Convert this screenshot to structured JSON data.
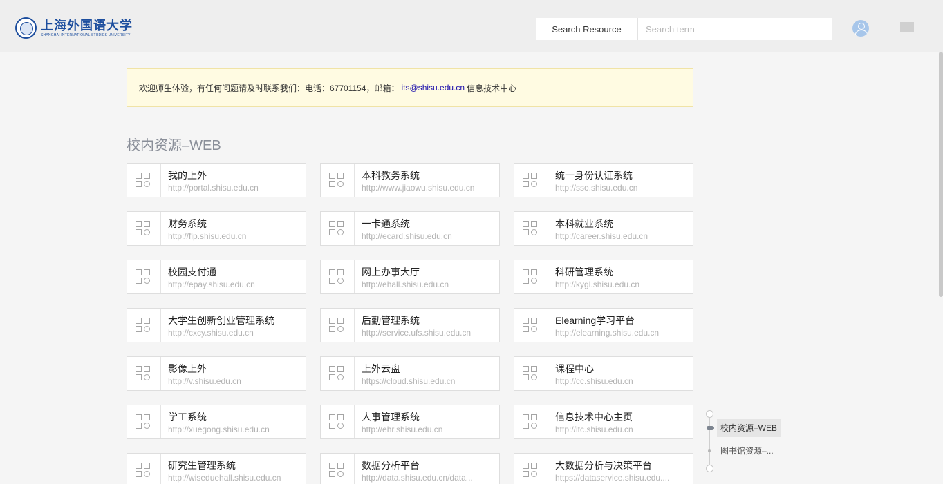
{
  "header": {
    "logo_cn": "上海外国语大学",
    "logo_en": "SHANGHAI INTERNATIONAL STUDIES UNIVERSITY",
    "search_button": "Search Resource",
    "search_placeholder": "Search term"
  },
  "notice": {
    "text_before": "欢迎师生体验，有任何问题请及时联系我们：电话：67701154，邮箱：",
    "email": "its@shisu.edu.cn",
    "text_after": "信息技术中心"
  },
  "section": {
    "title": "校内资源–WEB"
  },
  "cards": [
    {
      "title": "我的上外",
      "url": "http://portal.shisu.edu.cn"
    },
    {
      "title": "本科教务系统",
      "url": "http://www.jiaowu.shisu.edu.cn"
    },
    {
      "title": "统一身份认证系统",
      "url": "http://sso.shisu.edu.cn"
    },
    {
      "title": "财务系统",
      "url": "http://fip.shisu.edu.cn"
    },
    {
      "title": "一卡通系统",
      "url": "http://ecard.shisu.edu.cn"
    },
    {
      "title": "本科就业系统",
      "url": "http://career.shisu.edu.cn"
    },
    {
      "title": "校园支付通",
      "url": "http://epay.shisu.edu.cn"
    },
    {
      "title": "网上办事大厅",
      "url": "http://ehall.shisu.edu.cn"
    },
    {
      "title": "科研管理系统",
      "url": "http://kygl.shisu.edu.cn"
    },
    {
      "title": "大学生创新创业管理系统",
      "url": "http://cxcy.shisu.edu.cn"
    },
    {
      "title": "后勤管理系统",
      "url": "http://service.ufs.shisu.edu.cn"
    },
    {
      "title": "Elearning学习平台",
      "url": "http://elearning.shisu.edu.cn"
    },
    {
      "title": "影像上外",
      "url": "http://v.shisu.edu.cn"
    },
    {
      "title": "上外云盘",
      "url": "https://cloud.shisu.edu.cn"
    },
    {
      "title": "课程中心",
      "url": "http://cc.shisu.edu.cn"
    },
    {
      "title": "学工系统",
      "url": "http://xuegong.shisu.edu.cn"
    },
    {
      "title": "人事管理系统",
      "url": "http://ehr.shisu.edu.cn"
    },
    {
      "title": "信息技术中心主页",
      "url": "http://itc.shisu.edu.cn"
    },
    {
      "title": "研究生管理系统",
      "url": "http://wiseduehall.shisu.edu.cn"
    },
    {
      "title": "数据分析平台",
      "url": "http://data.shisu.edu.cn/data..."
    },
    {
      "title": "大数据分析与决策平台",
      "url": "https://dataservice.shisu.edu...."
    }
  ],
  "timeline": {
    "items": [
      {
        "label": "校内资源–WEB"
      },
      {
        "label": "图书馆资源–..."
      }
    ]
  },
  "colors": {
    "brand": "#1d4e9e",
    "notice_bg": "#fffbe2",
    "link": "#1a0dab"
  },
  "icons": {
    "card": "apps-grid-icon",
    "avatar": "user-avatar-icon",
    "menu": "menu-icon"
  }
}
